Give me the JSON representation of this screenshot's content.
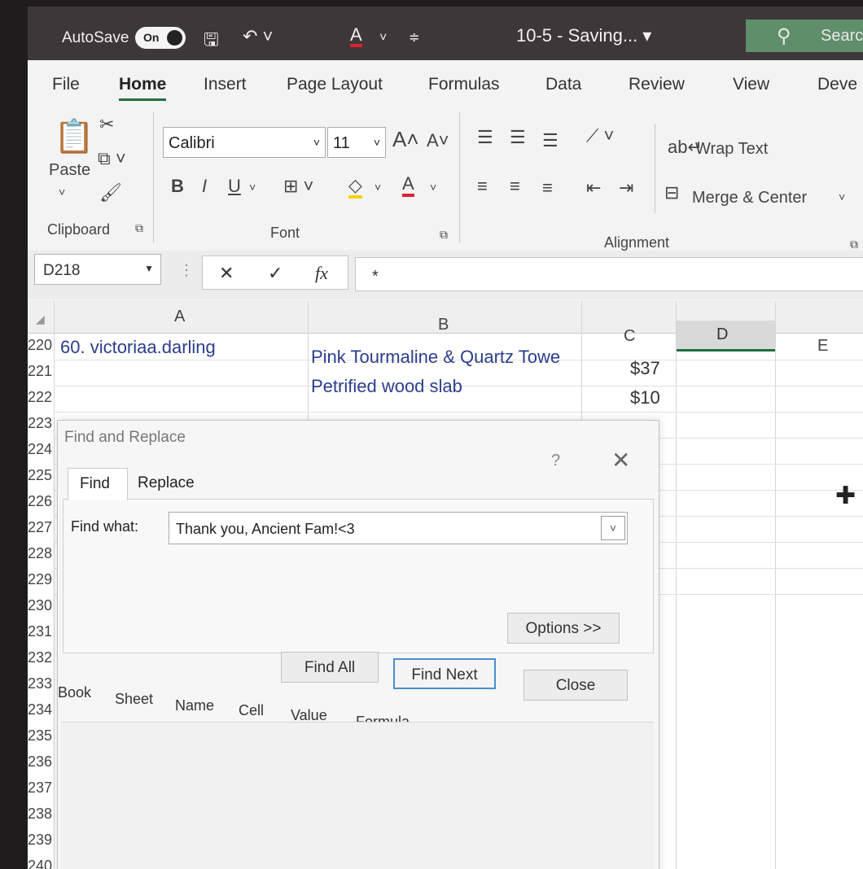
{
  "titlebar": {
    "autosave_label": "AutoSave",
    "autosave_state": "On",
    "doc_title": "10-5 - Saving... ▾",
    "search_label": "Searc"
  },
  "tabs": [
    "File",
    "Home",
    "Insert",
    "Page Layout",
    "Formulas",
    "Data",
    "Review",
    "View",
    "Deve"
  ],
  "ribbon": {
    "clipboard": {
      "paste_label": "Paste",
      "group_label": "Clipboard"
    },
    "font": {
      "font_name": "Calibri",
      "font_size": "11",
      "group_label": "Font",
      "bold": "B",
      "italic": "I",
      "underline": "U"
    },
    "alignment": {
      "wrap_text": "Wrap Text",
      "merge_center": "Merge & Center",
      "group_label": "Alignment"
    }
  },
  "formula_bar": {
    "name_box": "D218",
    "cancel": "✕",
    "enter": "✓",
    "fx": "fx",
    "content": "*"
  },
  "grid": {
    "columns": [
      "A",
      "B",
      "C",
      "D",
      "E"
    ],
    "rows": [
      "220",
      "221",
      "222",
      "223",
      "224",
      "225",
      "226",
      "227",
      "228",
      "229",
      "230",
      "231",
      "232",
      "233",
      "234",
      "235",
      "236",
      "237",
      "238",
      "239",
      "240"
    ],
    "cells": {
      "a220": "60. victoriaa.darling",
      "b220": "Pink Tourmaline & Quartz Towe",
      "c220": "$37",
      "b221": "Petrified wood slab",
      "c221": "$10"
    }
  },
  "dialog": {
    "title": "Find and Replace",
    "help": "?",
    "close_icon": "✕",
    "tabs": {
      "find": "Find",
      "replace": "Replace"
    },
    "find_what_label": "Find what:",
    "find_what_value": "Thank you, Ancient Fam!<3",
    "buttons": {
      "options": "Options >>",
      "find_all": "Find All",
      "find_next": "Find Next",
      "close": "Close"
    },
    "result_columns": [
      "Book",
      "Sheet",
      "Name",
      "Cell",
      "Value",
      "Formula"
    ]
  },
  "colors": {
    "excel_green": "#1f6e43",
    "titlebar": "#3d3739",
    "focus_blue": "#4a8ecb"
  }
}
